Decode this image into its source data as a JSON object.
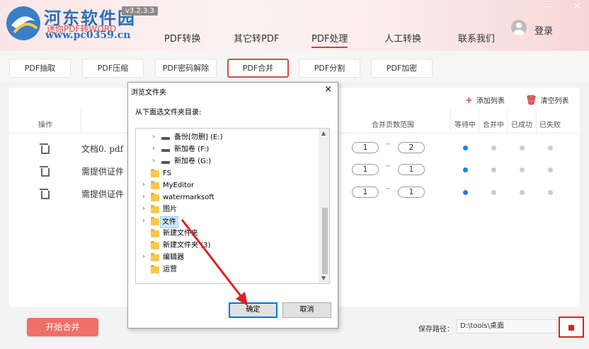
{
  "header": {
    "watermark_title": "河东软件园",
    "watermark_url": "www.pc0359.cn",
    "app_name": "迷你PDF转WORD",
    "version": "v3.2.3.3",
    "nav": [
      "PDF转换",
      "其它转PDF",
      "PDF处理",
      "人工转换",
      "联系我们"
    ],
    "active_nav": "PDF处理",
    "login": "登录",
    "window_controls": [
      "minimize-icon",
      "close-icon"
    ]
  },
  "subtabs": [
    "PDF抽取",
    "PDF压缩",
    "PDF密码解除",
    "PDF合并",
    "PDF分割",
    "PDF加密"
  ],
  "active_subtab": "PDF合并",
  "toolbar": {
    "add_list": "添加列表",
    "clear_list": "清空列表"
  },
  "table": {
    "headers": {
      "op": "操作",
      "range": "合并页数范围",
      "waiting": "等待中",
      "merging": "合并中",
      "success": "已成功",
      "failed": "已失败"
    },
    "rows": [
      {
        "name": "文档0. pdf",
        "from": "1",
        "to": "2"
      },
      {
        "name": "需提供证件",
        "from": "1",
        "to": "1"
      },
      {
        "name": "需提供证件",
        "from": "1",
        "to": "1"
      }
    ],
    "range_separator": "~"
  },
  "footer": {
    "start_button": "开始合并",
    "save_label": "保存路径：",
    "save_path": "D:\\tools\\桌面"
  },
  "dialog": {
    "title": "浏览文件夹",
    "close": "×",
    "instruction": "从下面选文件夹目录:",
    "tree": [
      {
        "label": "备份[勿删] (E:)",
        "type": "drive",
        "expandable": true
      },
      {
        "label": "新加卷 (F:)",
        "type": "drive",
        "expandable": true
      },
      {
        "label": "新加卷 (G:)",
        "type": "drive",
        "expandable": true
      },
      {
        "label": "FS",
        "type": "folder",
        "expandable": false
      },
      {
        "label": "MyEditor",
        "type": "folder",
        "expandable": true
      },
      {
        "label": "watermarksoft",
        "type": "folder",
        "expandable": true
      },
      {
        "label": "图片",
        "type": "folder",
        "expandable": true
      },
      {
        "label": "文件",
        "type": "folder",
        "expandable": true,
        "selected": true
      },
      {
        "label": "新建文件夹",
        "type": "folder",
        "expandable": false
      },
      {
        "label": "新建文件夹 (3)",
        "type": "folder",
        "expandable": false
      },
      {
        "label": "编辑器",
        "type": "folder",
        "expandable": true
      },
      {
        "label": "运营",
        "type": "folder",
        "expandable": false
      }
    ],
    "ok": "确定",
    "cancel": "取消"
  },
  "colors": {
    "accent": "#d34b47",
    "start_button": "#ef6f6a",
    "status_blue": "#1e7fe8",
    "highlight_red": "#e02020"
  }
}
